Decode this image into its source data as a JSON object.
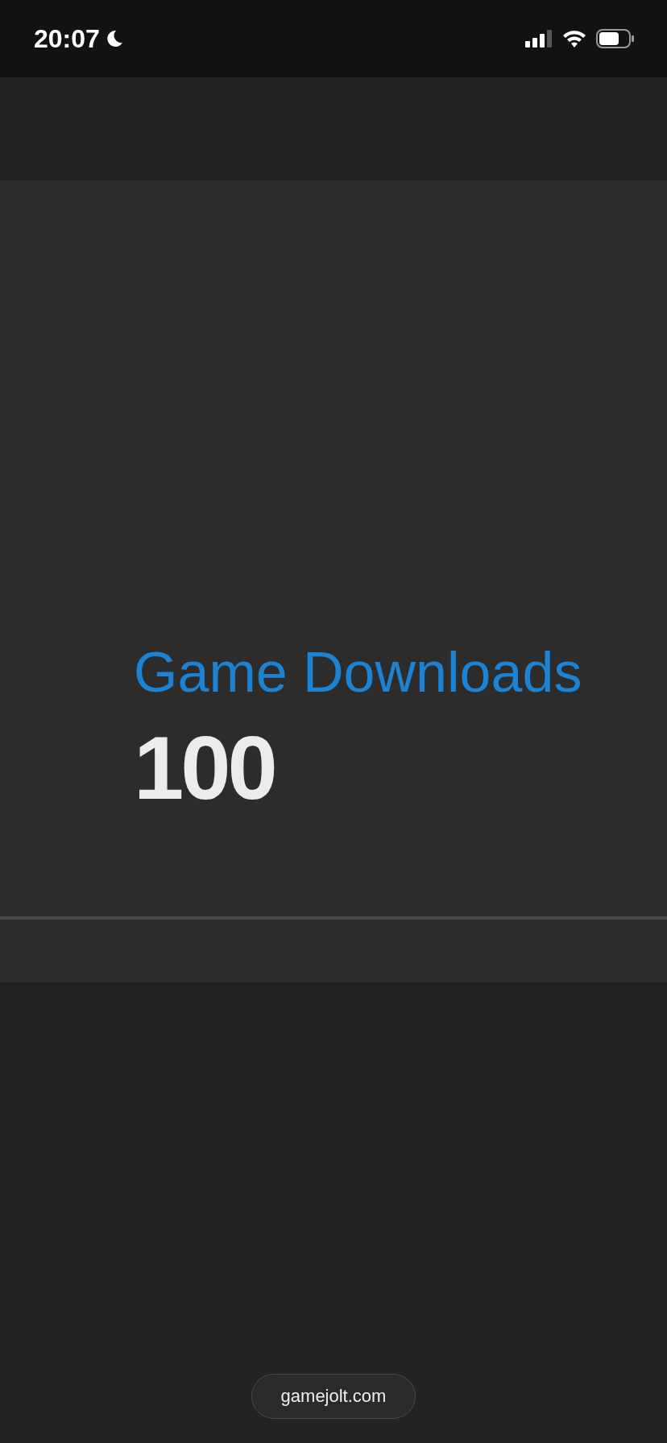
{
  "status_bar": {
    "time": "20:07",
    "do_not_disturb": true
  },
  "stat": {
    "label": "Game Downloads",
    "value": "100"
  },
  "address_bar": {
    "url": "gamejolt.com"
  }
}
